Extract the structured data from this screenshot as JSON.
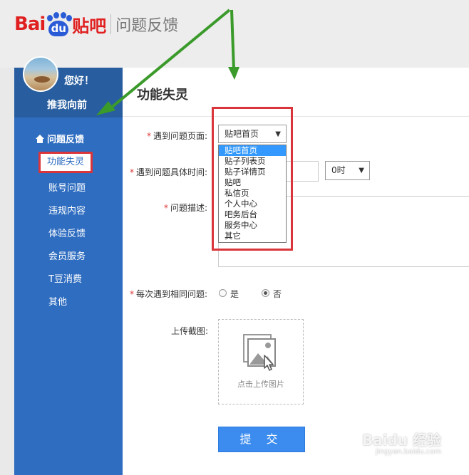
{
  "header": {
    "logo_bai": "Bai",
    "logo_du": "du",
    "logo_tieba": "贴吧",
    "subtitle": "问题反馈"
  },
  "sidebar": {
    "greeting": "您好！",
    "username": "推我向前",
    "section_title": "问题反馈",
    "items": [
      {
        "label": "功能失灵",
        "active": true
      },
      {
        "label": "账号问题"
      },
      {
        "label": "违规内容"
      },
      {
        "label": "体验反馈"
      },
      {
        "label": "会员服务"
      },
      {
        "label": "T豆消费"
      },
      {
        "label": "其他"
      }
    ]
  },
  "main": {
    "title": "功能失灵",
    "page_field": {
      "label": "遇到问题页面:",
      "selected": "贴吧首页",
      "options": [
        "贴吧首页",
        "贴子列表页",
        "贴子详情页",
        "贴吧",
        "私信页",
        "个人中心",
        "吧务后台",
        "服务中心",
        "其它"
      ]
    },
    "time_field": {
      "label": "遇到问题具体时间:",
      "hour_value": "0时"
    },
    "desc_field": {
      "label": "问题描述:"
    },
    "repeat_field": {
      "label": "每次遇到相同问题:",
      "yes": "是",
      "no": "否",
      "selected": "no"
    },
    "upload_field": {
      "label": "上传截图:",
      "hint": "点击上传图片"
    },
    "submit_label": "提 交"
  },
  "watermark": {
    "text": "Baidu 经验",
    "url": "jingyan.baidu.com"
  },
  "colors": {
    "sidebar": "#2f6dc0",
    "annotation": "#d9353a",
    "arrow": "#3a9a2a",
    "button": "#3b8cee"
  }
}
